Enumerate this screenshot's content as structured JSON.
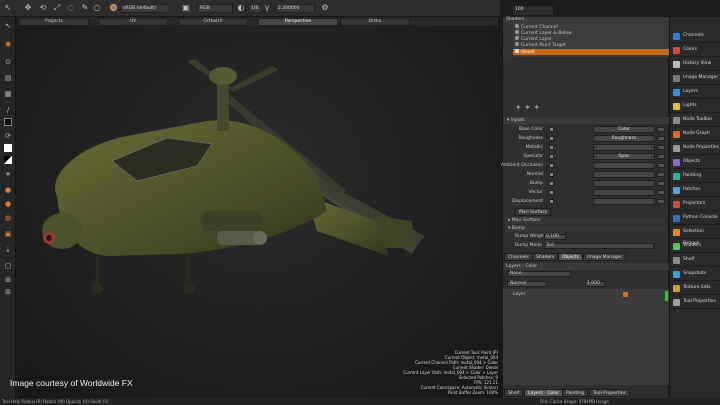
{
  "toolbar": {
    "colorspace": "sRGB (default)",
    "channel": "RGB",
    "exposure_label": "1/8",
    "gamma": "2.200000",
    "brush_size": "100"
  },
  "tabs": [
    {
      "label": "Projects"
    },
    {
      "label": "UV"
    },
    {
      "label": "OrthoUV"
    },
    {
      "label": "Perspective"
    },
    {
      "label": "Ortho"
    }
  ],
  "shaders_panel": {
    "title": "Shaders",
    "items": [
      "Current Channel",
      "Current Layer & Below",
      "Current Layer",
      "Current Paint Target",
      "diesel"
    ]
  },
  "inputs": {
    "title": "Inputs",
    "rows": [
      {
        "label": "Base Color",
        "value": "Color"
      },
      {
        "label": "Roughness",
        "value": "Roughness"
      },
      {
        "label": "Metallic",
        "value": ""
      },
      {
        "label": "Specular",
        "value": "Spec"
      },
      {
        "label": "Ambient Occlusion",
        "value": ""
      },
      {
        "label": "Normal",
        "value": ""
      },
      {
        "label": "Bump",
        "value": ""
      },
      {
        "label": "Vector",
        "value": ""
      },
      {
        "label": "Displacement",
        "value": ""
      }
    ],
    "section_tab": "Mari Surface",
    "sub_sections": [
      "Mari Surface",
      "Bump"
    ],
    "bump_weight_label": "Bump Weight",
    "bump_weight": "0.100",
    "bump_mode_label": "Bump Mode",
    "bump_mode": "Tod"
  },
  "panel_tabs": [
    "Channels",
    "Shaders",
    "Objects",
    "Image Manager"
  ],
  "layers_panel": {
    "title": "Layers - Color",
    "channel": "None",
    "blend_mode": "Normal",
    "opacity": "1.000",
    "layer_name": "Layer",
    "bottom_tabs": [
      "Shelf",
      "Layers - Color",
      "Painting",
      "Tool Properties"
    ]
  },
  "sidebar": {
    "items": [
      {
        "label": "Channels",
        "color": "#3a7bd5"
      },
      {
        "label": "Colors",
        "color": "#d04848"
      },
      {
        "label": "History View",
        "color": "#bbbbbb"
      },
      {
        "label": "Image Manager",
        "color": "#7a7a7a"
      },
      {
        "label": "Layers",
        "color": "#3d8fd8"
      },
      {
        "label": "Lights",
        "color": "#e0c040"
      },
      {
        "label": "Node Toolbar",
        "color": "#8a8a8a"
      },
      {
        "label": "Node Graph",
        "color": "#d46c2c"
      },
      {
        "label": "Node Properties",
        "color": "#9a9a9a"
      },
      {
        "label": "Objects",
        "color": "#8a6cc0"
      },
      {
        "label": "Painting",
        "color": "#2fb0a0"
      },
      {
        "label": "Patches",
        "color": "#5a9fd0"
      },
      {
        "label": "Projectors",
        "color": "#c05050"
      },
      {
        "label": "Python Console",
        "color": "#3c6fb0"
      },
      {
        "label": "Selection Groups",
        "color": "#e08a30"
      },
      {
        "label": "Shaders",
        "color": "#5ac060"
      },
      {
        "label": "Shelf",
        "color": "#8c8c8c"
      },
      {
        "label": "Snapshots",
        "color": "#40a0d0"
      },
      {
        "label": "Texture Sets",
        "color": "#d0a040"
      },
      {
        "label": "Tool Properties",
        "color": "#a0a0a0"
      }
    ]
  },
  "viewport_info": [
    "Current Tool: Paint (P)",
    "Current Object: metal_004",
    "Current Channel Path: metal_004 > Color",
    "Current Shader: Diesel",
    "Current Layer Path: metal_004 > Color > Layer",
    "Selected Patches: 0",
    "FPS: 121.21",
    "Current Colorspace: Automatic (linear)",
    "Paint Buffer Zoom: 100%"
  ],
  "credit": "Image courtesy of Worldwide FX",
  "status": {
    "left": "Tool Help   Radius (R)   Rotate (W)   Opacity (O)   Soulti (S)",
    "right": "Disk Cache Usage: 4784MB   Usage"
  }
}
